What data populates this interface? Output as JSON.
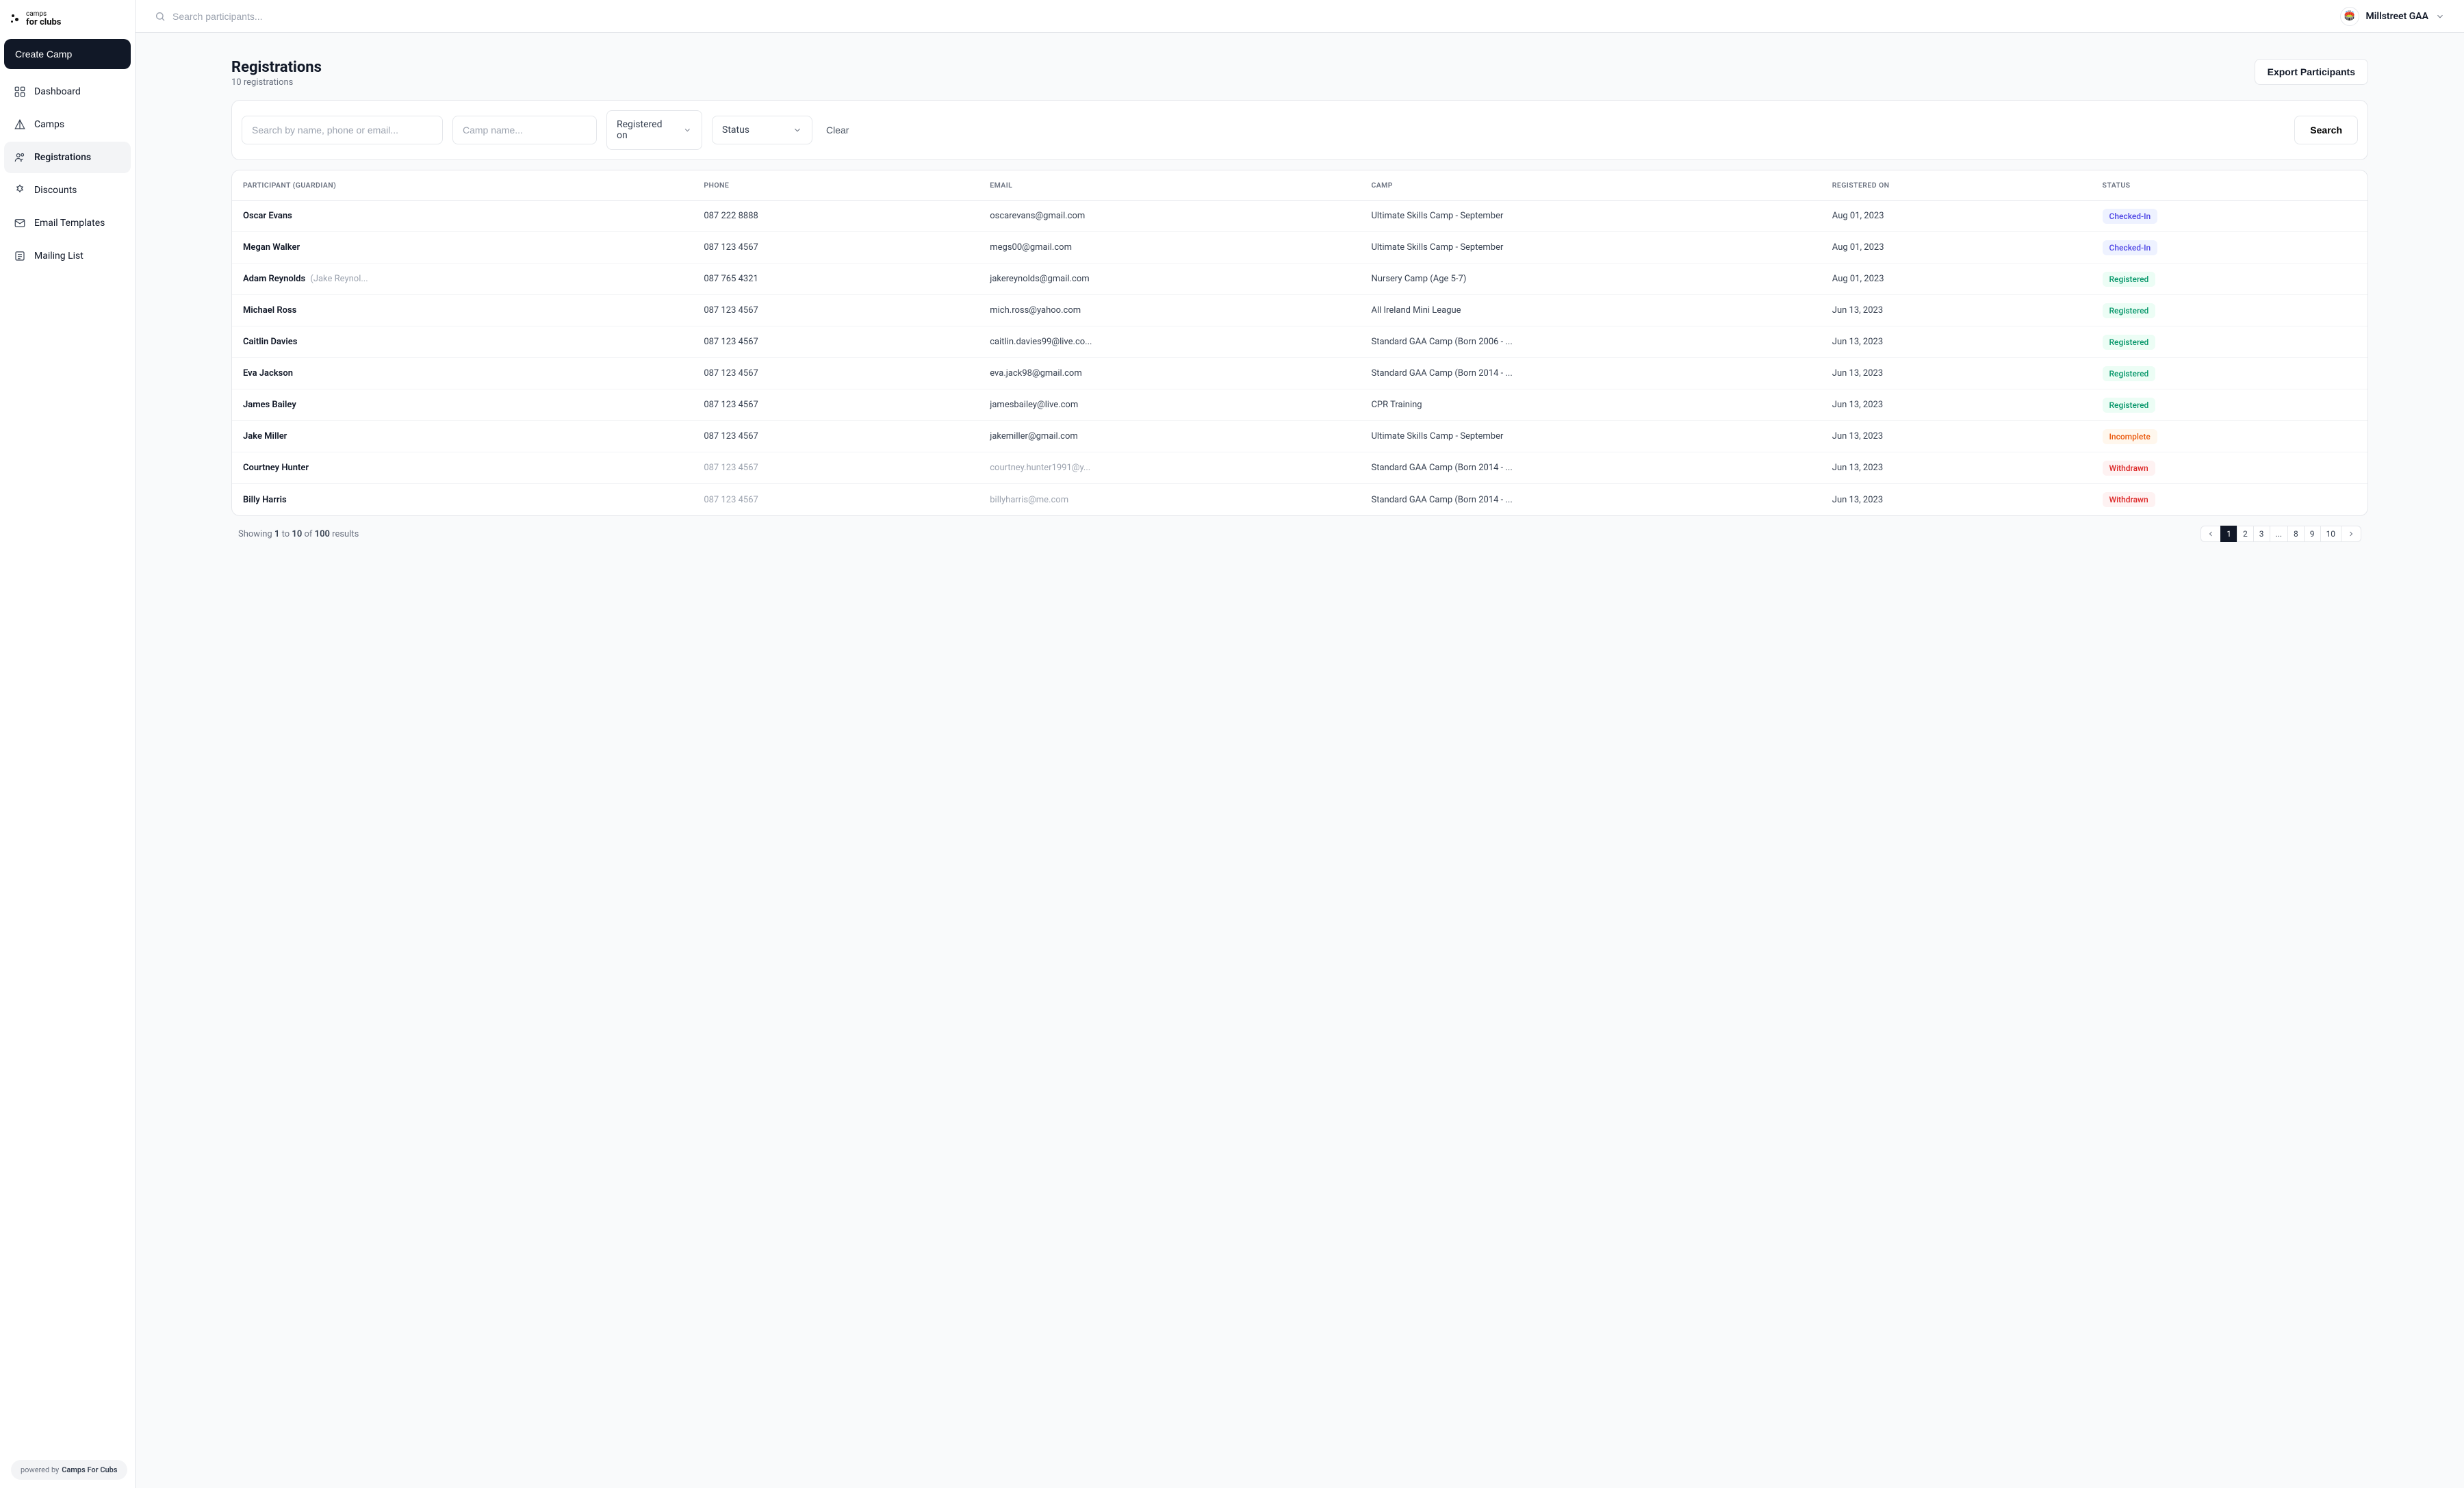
{
  "brand": {
    "line1": "camps",
    "line2": "for clubs"
  },
  "sidebar": {
    "create_label": "Create Camp",
    "items": [
      {
        "label": "Dashboard"
      },
      {
        "label": "Camps"
      },
      {
        "label": "Registrations"
      },
      {
        "label": "Discounts"
      },
      {
        "label": "Email Templates"
      },
      {
        "label": "Mailing List"
      }
    ],
    "powered_prefix": "powered by",
    "powered_name": "Camps For Cubs"
  },
  "topbar": {
    "search_placeholder": "Search participants...",
    "org_name": "Millstreet GAA",
    "org_avatar_emoji": "🏟️"
  },
  "page": {
    "title": "Registrations",
    "sub": "10 registrations",
    "export_label": "Export Participants"
  },
  "filters": {
    "search_placeholder": "Search by name, phone or email...",
    "camp_placeholder": "Camp name...",
    "registered_on_label": "Registered on",
    "status_label": "Status",
    "clear_label": "Clear",
    "search_label": "Search"
  },
  "table": {
    "headers": {
      "participant": "PARTICIPANT (GUARDIAN)",
      "phone": "PHONE",
      "email": "EMAIL",
      "camp": "CAMP",
      "registered_on": "REGISTERED ON",
      "status": "STATUS"
    },
    "rows": [
      {
        "participant": "Oscar Evans",
        "guardian": "",
        "phone": "087 222 8888",
        "email": "oscarevans@gmail.com",
        "camp": "Ultimate Skills Camp - September",
        "registered_on": "Aug 01, 2023",
        "status": "Checked-In",
        "status_class": "checkedin",
        "muted": false
      },
      {
        "participant": "Megan Walker",
        "guardian": "",
        "phone": "087 123 4567",
        "email": "megs00@gmail.com",
        "camp": "Ultimate Skills Camp - September",
        "registered_on": "Aug 01, 2023",
        "status": "Checked-In",
        "status_class": "checkedin",
        "muted": false
      },
      {
        "participant": "Adam Reynolds",
        "guardian": "(Jake Reynol...",
        "phone": "087 765 4321",
        "email": "jakereynolds@gmail.com",
        "camp": "Nursery Camp (Age 5-7)",
        "registered_on": "Aug 01, 2023",
        "status": "Registered",
        "status_class": "registered",
        "muted": false
      },
      {
        "participant": "Michael Ross",
        "guardian": "",
        "phone": "087 123 4567",
        "email": "mich.ross@yahoo.com",
        "camp": "All Ireland Mini League",
        "registered_on": "Jun 13, 2023",
        "status": "Registered",
        "status_class": "registered",
        "muted": false
      },
      {
        "participant": "Caitlin Davies",
        "guardian": "",
        "phone": "087 123 4567",
        "email": "caitlin.davies99@live.co...",
        "camp": "Standard GAA Camp (Born 2006 - ...",
        "registered_on": "Jun 13, 2023",
        "status": "Registered",
        "status_class": "registered",
        "muted": false
      },
      {
        "participant": "Eva Jackson",
        "guardian": "",
        "phone": "087 123 4567",
        "email": "eva.jack98@gmail.com",
        "camp": "Standard GAA Camp (Born 2014 - ...",
        "registered_on": "Jun 13, 2023",
        "status": "Registered",
        "status_class": "registered",
        "muted": false
      },
      {
        "participant": "James Bailey",
        "guardian": "",
        "phone": "087 123 4567",
        "email": "jamesbailey@live.com",
        "camp": "CPR Training",
        "registered_on": "Jun 13, 2023",
        "status": "Registered",
        "status_class": "registered",
        "muted": false
      },
      {
        "participant": "Jake Miller",
        "guardian": "",
        "phone": "087 123 4567",
        "email": "jakemiller@gmail.com",
        "camp": "Ultimate Skills Camp - September",
        "registered_on": "Jun 13, 2023",
        "status": "Incomplete",
        "status_class": "incomplete",
        "muted": false
      },
      {
        "participant": "Courtney Hunter",
        "guardian": "",
        "phone": "087 123 4567",
        "email": "courtney.hunter1991@y...",
        "camp": "Standard GAA Camp (Born 2014 - ...",
        "registered_on": "Jun 13, 2023",
        "status": "Withdrawn",
        "status_class": "withdrawn",
        "muted": true
      },
      {
        "participant": "Billy Harris",
        "guardian": "",
        "phone": "087 123 4567",
        "email": "billyharris@me.com",
        "camp": "Standard GAA Camp (Born 2014 - ...",
        "registered_on": "Jun 13, 2023",
        "status": "Withdrawn",
        "status_class": "withdrawn",
        "muted": true
      }
    ]
  },
  "pagination": {
    "showing_prefix": "Showing",
    "from": "1",
    "to_word": "to",
    "to": "10",
    "of_word": "of",
    "total": "100",
    "results_word": "results",
    "pages": [
      "1",
      "2",
      "3",
      "...",
      "8",
      "9",
      "10"
    ],
    "current": "1"
  }
}
